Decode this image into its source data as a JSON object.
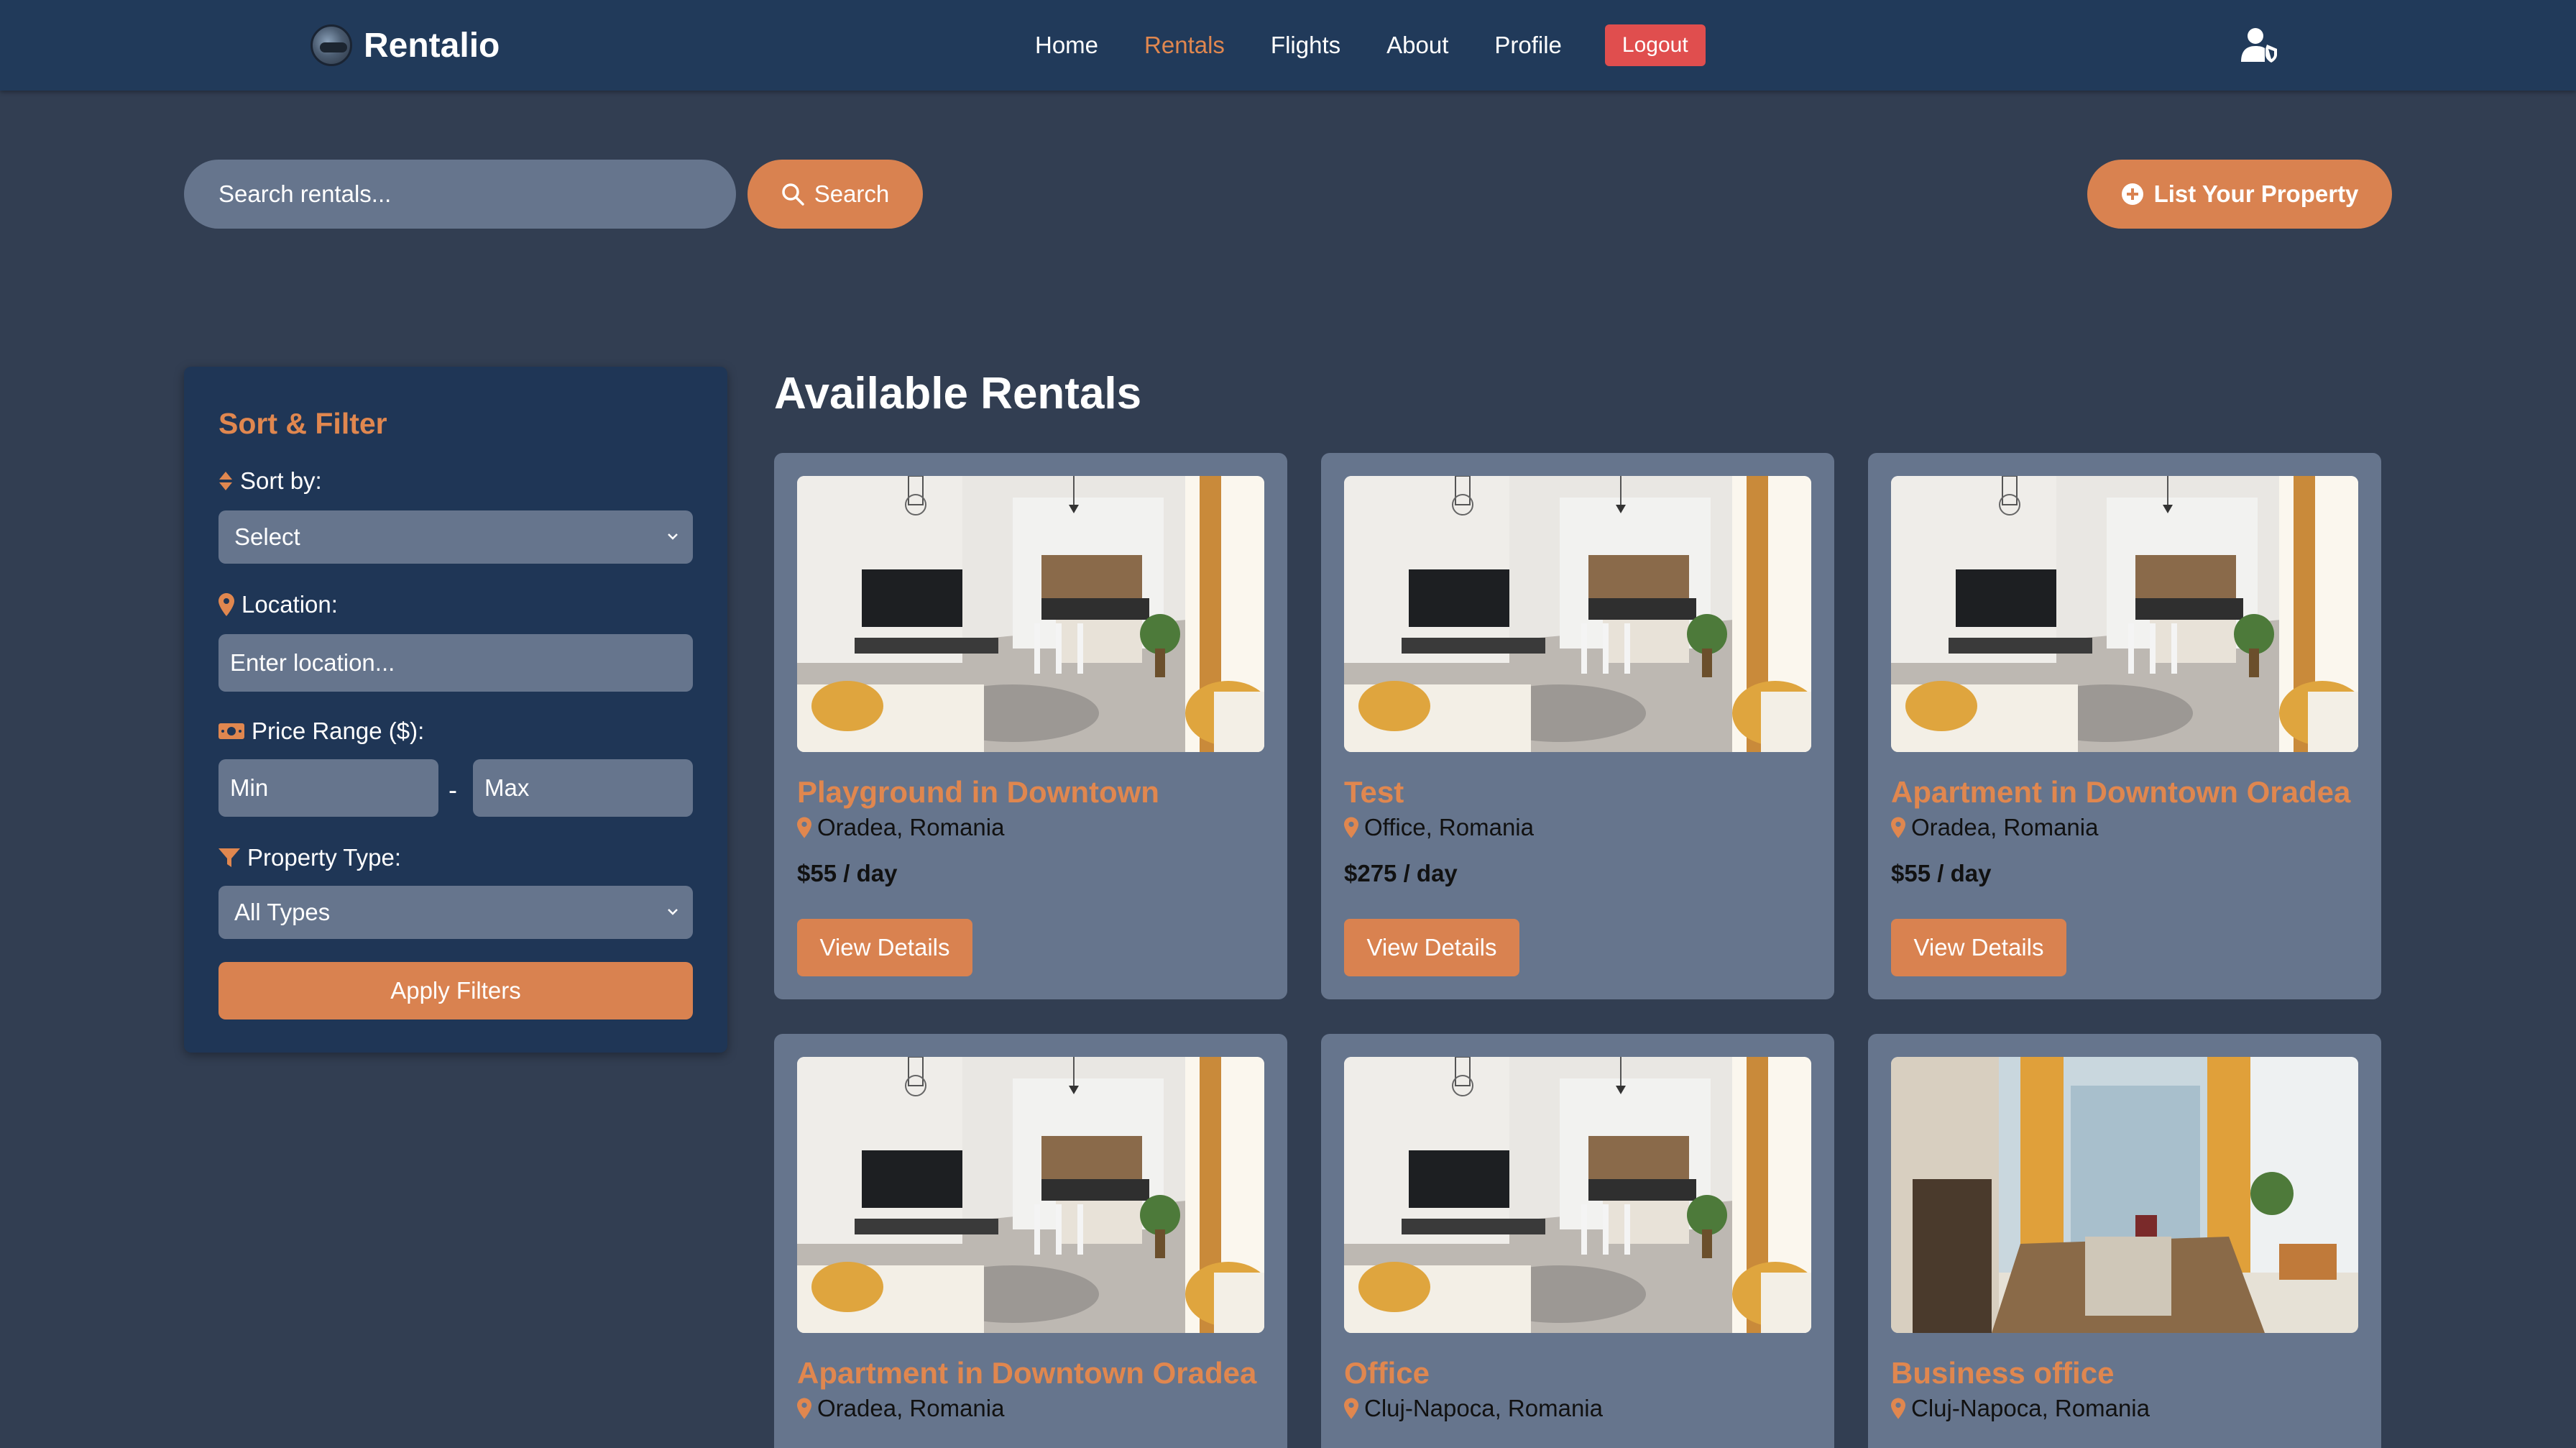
{
  "brand": {
    "name": "Rentalio",
    "logo_icon": "globe-logo-icon"
  },
  "nav": {
    "links": [
      {
        "label": "Home",
        "active": false
      },
      {
        "label": "Rentals",
        "active": true
      },
      {
        "label": "Flights",
        "active": false
      },
      {
        "label": "About",
        "active": false
      },
      {
        "label": "Profile",
        "active": false
      }
    ],
    "logout_label": "Logout",
    "user_icon": "user-shield-icon"
  },
  "search": {
    "placeholder": "Search rentals...",
    "button_label": "Search",
    "list_property_label": "List Your Property"
  },
  "filters": {
    "title": "Sort & Filter",
    "sort_label": "Sort by:",
    "sort_value": "Select",
    "location_label": "Location:",
    "location_placeholder": "Enter location...",
    "price_label": "Price Range ($):",
    "price_min_placeholder": "Min",
    "price_max_placeholder": "Max",
    "price_separator": "-",
    "type_label": "Property Type:",
    "type_value": "All Types",
    "apply_label": "Apply Filters"
  },
  "rentals": {
    "title": "Available Rentals",
    "view_label": "View Details",
    "items": [
      {
        "title": "Playground in Downtown",
        "location": "Oradea, Romania",
        "price": "$55 / day",
        "image": "living-room"
      },
      {
        "title": "Test",
        "location": "Office, Romania",
        "price": "$275 / day",
        "image": "living-room"
      },
      {
        "title": "Apartment in Downtown Oradea",
        "location": "Oradea, Romania",
        "price": "$55 / day",
        "image": "living-room"
      },
      {
        "title": "Apartment in Downtown Oradea",
        "location": "Oradea, Romania",
        "price": "",
        "image": "living-room"
      },
      {
        "title": "Office",
        "location": "Cluj-Napoca, Romania",
        "price": "",
        "image": "living-room"
      },
      {
        "title": "Business office",
        "location": "Cluj-Napoca, Romania",
        "price": "",
        "image": "kitchen-dining"
      }
    ]
  },
  "colors": {
    "page_bg": "#323e52",
    "navbar_bg": "#213a5a",
    "accent": "#d98250",
    "accent_text": "#e0874f",
    "logout": "#e04e4e",
    "card_bg": "#66758d"
  }
}
